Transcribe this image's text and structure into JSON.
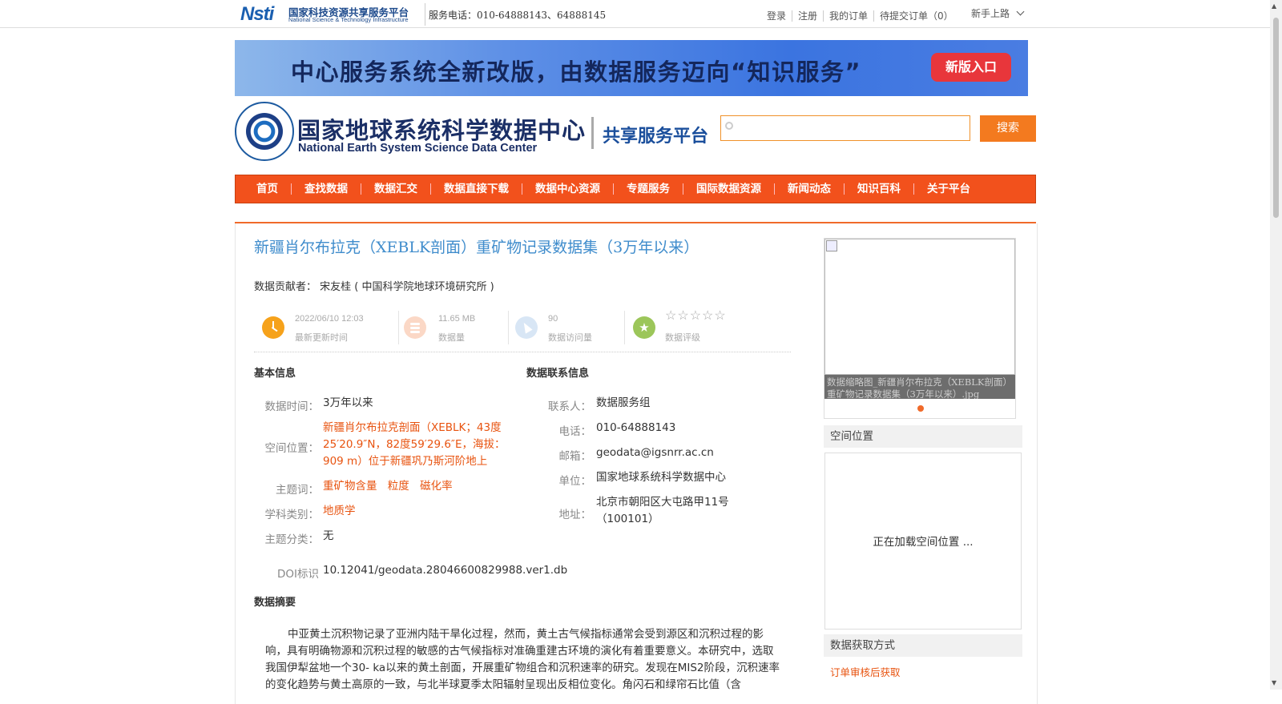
{
  "topbar": {
    "logo_mark": "Nsti",
    "logo_cn": "国家科技资源共享服务平台",
    "logo_en": "National Science & Technology Infrastructure",
    "phone": "服务电话：010-64888143、64888145",
    "links": [
      "登录",
      "注册",
      "我的订单",
      "待提交订单（0）"
    ],
    "newbie": "新手上路"
  },
  "banner": {
    "text": "中心服务系统全新改版，由数据服务迈向“知识服务”",
    "button": "新版入口"
  },
  "header": {
    "logo_cn": "国家地球系统科学数据中心",
    "logo_en": "National Earth System Science Data Center",
    "logo_sub": "共享服务平台",
    "search_placeholder": "",
    "search_button": "搜索"
  },
  "nav": [
    "首页",
    "查找数据",
    "数据汇交",
    "数据直接下载",
    "数据中心资源",
    "专题服务",
    "国际数据资源",
    "新闻动态",
    "知识百科",
    "关于平台"
  ],
  "dataset": {
    "title": "新疆肖尔布拉克（XEBLK剖面）重矿物记录数据集（3万年以来）",
    "contributor_label": "数据贡献者：",
    "contributor": "宋友桂 ( 中国科学院地球环境研究所 )",
    "stats": {
      "updated_value": "2022/06/10 12:03",
      "updated_label": "最新更新时间",
      "size_value": "11.65 MB",
      "size_label": "数据量",
      "visits_value": "90",
      "visits_label": "数据访问量",
      "rating_stars": "☆☆☆☆☆",
      "rating_label": "数据评级"
    },
    "basic": {
      "section": "基本信息",
      "time_label": "数据时间：",
      "time_value": "3万年以来",
      "space_label": "空间位置：",
      "space_value": "新疆肖尔布拉克剖面（XEBLK；43度25′20.9″N，82度59′29.6″E，海拔：909 m）位于新疆巩乃斯河阶地上",
      "keywords_label": "主题词：",
      "keywords": [
        "重矿物含量",
        "粒度",
        "磁化率"
      ],
      "discipline_label": "学科类别：",
      "discipline": "地质学",
      "category_label": "主题分类：",
      "category": "无",
      "doi_label": "DOI标识",
      "doi": "10.12041/geodata.28046600829988.ver1.db"
    },
    "contact": {
      "section": "数据联系信息",
      "person_label": "联系人：",
      "person": "数据服务组",
      "phone_label": "电话：",
      "phone": "010-64888143",
      "email_label": "邮箱：",
      "email": "geodata@igsnrr.ac.cn",
      "unit_label": "单位：",
      "unit": "国家地球系统科学数据中心",
      "address_label": "地址：",
      "address": "北京市朝阳区大屯路甲11号（100101）"
    },
    "abstract_title": "数据摘要",
    "abstract": "中亚黄土沉积物记录了亚洲内陆干旱化过程，然而，黄土古气候指标通常会受到源区和沉积过程的影响，具有明确物源和沉积过程的敏感的古气候指标对准确重建古环境的演化有着重要意义。本研究中，选取我国伊犁盆地一个30- ka以来的黄土剖面，开展重矿物组合和沉积速率的研究。发现在MIS2阶段，沉积速率的变化趋势与黄土高原的一致，与北半球夏季太阳辐射呈现出反相位变化。角闪石和绿帘石比值（含"
  },
  "sidebar": {
    "thumb_caption": "数据缩略图_新疆肖尔布拉克（XEBLK剖面）重矿物记录数据集（3万年以来）.jpg",
    "space_title": "空间位置",
    "map_loading": "正在加载空间位置 ...",
    "access_title": "数据获取方式",
    "access_link": "订单审核后获取"
  }
}
